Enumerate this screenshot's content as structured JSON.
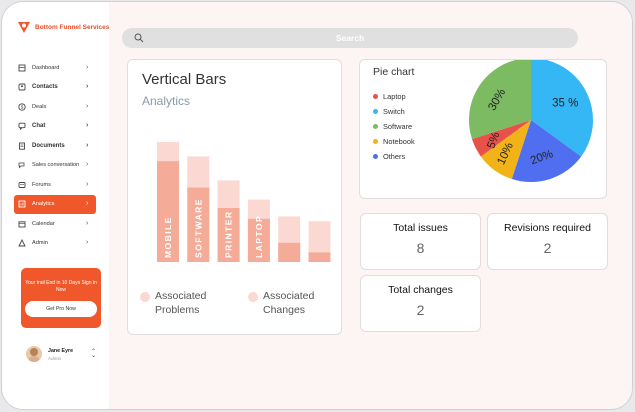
{
  "brand": {
    "name": "Bottom Funnel Services",
    "color": "#f0582c"
  },
  "search": {
    "placeholder": "Search",
    "icon": "search-icon"
  },
  "sidebar": {
    "items": [
      {
        "label": "Dashboard",
        "icon": "grid-icon",
        "bold": false,
        "active": false
      },
      {
        "label": "Contacts",
        "icon": "contacts-icon",
        "bold": true,
        "active": false
      },
      {
        "label": "Deals",
        "icon": "dollar-icon",
        "bold": false,
        "active": false
      },
      {
        "label": "Chat",
        "icon": "chat-icon",
        "bold": true,
        "active": false
      },
      {
        "label": "Documents",
        "icon": "document-icon",
        "bold": true,
        "active": false
      },
      {
        "label": "Sales conversation",
        "icon": "conversation-icon",
        "bold": false,
        "active": false
      },
      {
        "label": "Forums",
        "icon": "forum-icon",
        "bold": false,
        "active": false
      },
      {
        "label": "Analytics",
        "icon": "analytics-icon",
        "bold": false,
        "active": true
      },
      {
        "label": "Calendar",
        "icon": "calendar-icon",
        "bold": false,
        "active": false
      },
      {
        "label": "Admin",
        "icon": "admin-icon",
        "bold": false,
        "active": false
      }
    ]
  },
  "promo": {
    "text": "Your trail End in 10 Days Sign in Now",
    "button": "Get Pro Now"
  },
  "user": {
    "name": "Jane Eyre",
    "role": "Admin"
  },
  "bars_card": {
    "title": "Vertical Bars",
    "subtitle": "Analytics",
    "legend": [
      "Associated Problems",
      "Associated Changes"
    ]
  },
  "pie_card": {
    "title": "Pie chart"
  },
  "chart_data": [
    {
      "type": "bar",
      "categories": [
        "MOBILE",
        "SOFTWARE",
        "PRINTER",
        "LAPTOP",
        "",
        ""
      ],
      "series": [
        {
          "name": "Associated Problems",
          "values": [
            84,
            62,
            45,
            36,
            16,
            8
          ]
        },
        {
          "name": "Associated Changes",
          "values": [
            100,
            88,
            68,
            52,
            38,
            34
          ]
        }
      ],
      "colors": {
        "Associated Problems": "#f4ab97",
        "Associated Changes": "#fbd9d2"
      },
      "grid": false
    },
    {
      "type": "pie",
      "labels": [
        "Switch",
        "Others",
        "Notebook",
        "Laptop",
        "Software"
      ],
      "values": [
        35,
        20,
        10,
        5,
        30
      ],
      "label_text": [
        "35 %",
        "20%",
        "10%",
        "5%",
        "30%"
      ],
      "legend": [
        "Laptop",
        "Switch",
        "Software",
        "Notebook",
        "Others"
      ],
      "colors": {
        "Laptop": "#e8514a",
        "Switch": "#35b6f5",
        "Software": "#7cbb61",
        "Notebook": "#f1b318",
        "Others": "#4f6ff0"
      },
      "legend_position": "left"
    }
  ],
  "stats": [
    {
      "label": "Total issues",
      "value": "8"
    },
    {
      "label": "Revisions required",
      "value": "2"
    },
    {
      "label": "Total changes",
      "value": "2"
    }
  ]
}
